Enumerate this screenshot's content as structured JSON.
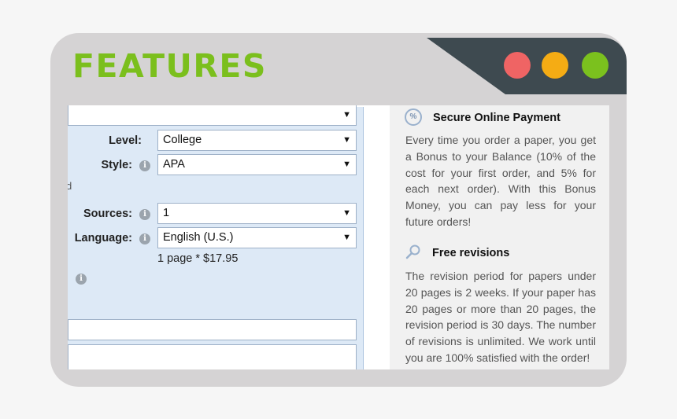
{
  "header": {
    "title": "FEATURES",
    "window_dots": [
      "#ef6464",
      "#f5ac14",
      "#7bc11e"
    ]
  },
  "form": {
    "top_select": {
      "value": ""
    },
    "level": {
      "label": "Level:",
      "value": "College"
    },
    "style": {
      "label": "Style:",
      "value": "APA"
    },
    "cut_off_char": "d",
    "sources": {
      "label": "Sources:",
      "value": "1"
    },
    "language": {
      "label": "Language:",
      "value": "English (U.S.)"
    },
    "price_line": "1 page * $17.95",
    "info_glyph": "i",
    "dropdown_arrow": "▼"
  },
  "features": {
    "payment": {
      "icon": "percent-icon",
      "icon_glyph": "%",
      "title": "Secure Online Payment",
      "text": "Every time you order a paper, you get a Bonus to your Balance (10% of the cost for your first order, and 5% for each next order). With this Bonus Money, you can pay less for your future orders!"
    },
    "revisions": {
      "icon": "search-icon",
      "title": "Free revisions",
      "text": "The revision period for papers under 20 pages is 2 weeks. If your paper has 20 pages or more than 20 pages, the revision period is 30 days. The number of revisions is unlimited. We work until you are 100% satisfied with the order!"
    }
  }
}
